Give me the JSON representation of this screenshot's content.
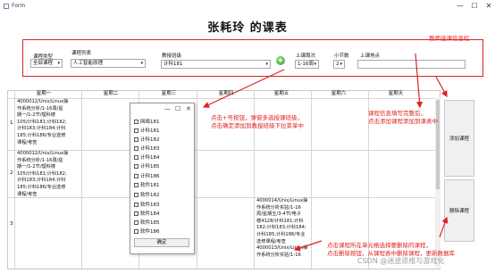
{
  "window": {
    "title": "Form",
    "minimize": "—",
    "maximize": "☐",
    "close": "✕"
  },
  "app_title": "张耗玲 的课表",
  "panel": {
    "course_type_label": "课程类型",
    "course_type_value": "全部课程",
    "course_list_label": "课程列表",
    "course_list_value": "人工智能原理",
    "class_label": "教授班级",
    "class_value": "计科181",
    "week_label": "上课周次",
    "week_value": "1-16周",
    "section_label": "小节数",
    "section_value": "2",
    "location_label": "上课地点",
    "location_value": ""
  },
  "annotations": {
    "panel_note": "教师选课信息栏",
    "popup_note_1": "点击+号按钮，弹窗多选授课班级，",
    "popup_note_2": "点击确定添加到教授班级下拉菜单中",
    "add_note_1": "课程信息填写完整后，",
    "add_note_2": "点击添加课程添加到课表中",
    "delete_note_1": "点击课程所在单元格选择要删除的课程，",
    "delete_note_2": "点击删除按钮，从课程表中删除课程，更新数据库",
    "watermark": "CSDN @迷途思维与游戏化"
  },
  "table": {
    "headers": [
      "星期一",
      "星期二",
      "星期三",
      "星期四",
      "星期五",
      "星期六",
      "星期天"
    ],
    "row_numbers": [
      "1",
      "2",
      "3"
    ],
    "cell_r1_mon": "4000012/Unix/Linux操\n作系统分析/1-16周/星\n期一/1-2节/理科楼\n105/计科181;计科182;\n计科183;计科184;计科\n185;计科186/专业选修\n课程/考查",
    "cell_r2_mon": "4000012/Unix/Linux操\n作系统分析/1-16周/星\n期一/1-2节/理科楼\n105/计科181;计科182;\n计科183;计科184;计科\n185;计科186/专业选修\n课程/考查",
    "cell_r3_fri": "4000014/Unix/Linux操\n作系统分析实验/1-16\n周/星期五/3-4节/电子\n楼4128/计科181;计科\n182;计科183;计科184;\n计科185;计科186/专业\n选修课程/考查\n4000013/Unix/Linux操\n作系统分析实验/1-16"
  },
  "buttons": {
    "add_course": "添加课程",
    "delete_course": "删除课程"
  },
  "popup": {
    "items": [
      "网络181",
      "计科181",
      "计科182",
      "计科183",
      "计科184",
      "计科185",
      "计科186",
      "软件181",
      "软件182",
      "软件183",
      "软件184",
      "软件185",
      "软件186"
    ],
    "ok": "确定",
    "controls": [
      "—",
      "☐",
      "✕"
    ]
  },
  "colors": {
    "annotation": "#e02020",
    "add_button": "#3a9a2a"
  }
}
